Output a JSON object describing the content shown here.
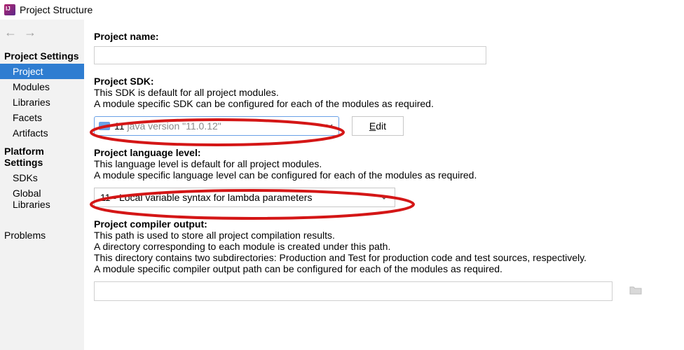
{
  "title": "Project Structure",
  "sidebar": {
    "settings_head": "Project Settings",
    "platform_head": "Platform Settings",
    "items": {
      "project": "Project",
      "modules": "Modules",
      "libraries": "Libraries",
      "facets": "Facets",
      "artifacts": "Artifacts",
      "sdks": "SDKs",
      "globallibs": "Global Libraries",
      "problems": "Problems"
    }
  },
  "main": {
    "project_name_label": "Project name:",
    "project_name_value": "",
    "sdk_label": "Project SDK:",
    "sdk_desc1": "This SDK is default for all project modules.",
    "sdk_desc2": "A module specific SDK can be configured for each of the modules as required.",
    "sdk_value_num": "11",
    "sdk_value_gray": "java version \"11.0.12\"",
    "edit_label_u": "E",
    "edit_label_rest": "dit",
    "lang_label": "Project language level:",
    "lang_desc1": "This language level is default for all project modules.",
    "lang_desc2": "A module specific language level can be configured for each of the modules as required.",
    "lang_value": "11 - Local variable syntax for lambda parameters",
    "out_label": "Project compiler output:",
    "out_desc1": "This path is used to store all project compilation results.",
    "out_desc2": "A directory corresponding to each module is created under this path.",
    "out_desc3": "This directory contains two subdirectories: Production and Test for production code and test sources, respectively.",
    "out_desc4": "A module specific compiler output path can be configured for each of the modules as required.",
    "out_value": ""
  }
}
